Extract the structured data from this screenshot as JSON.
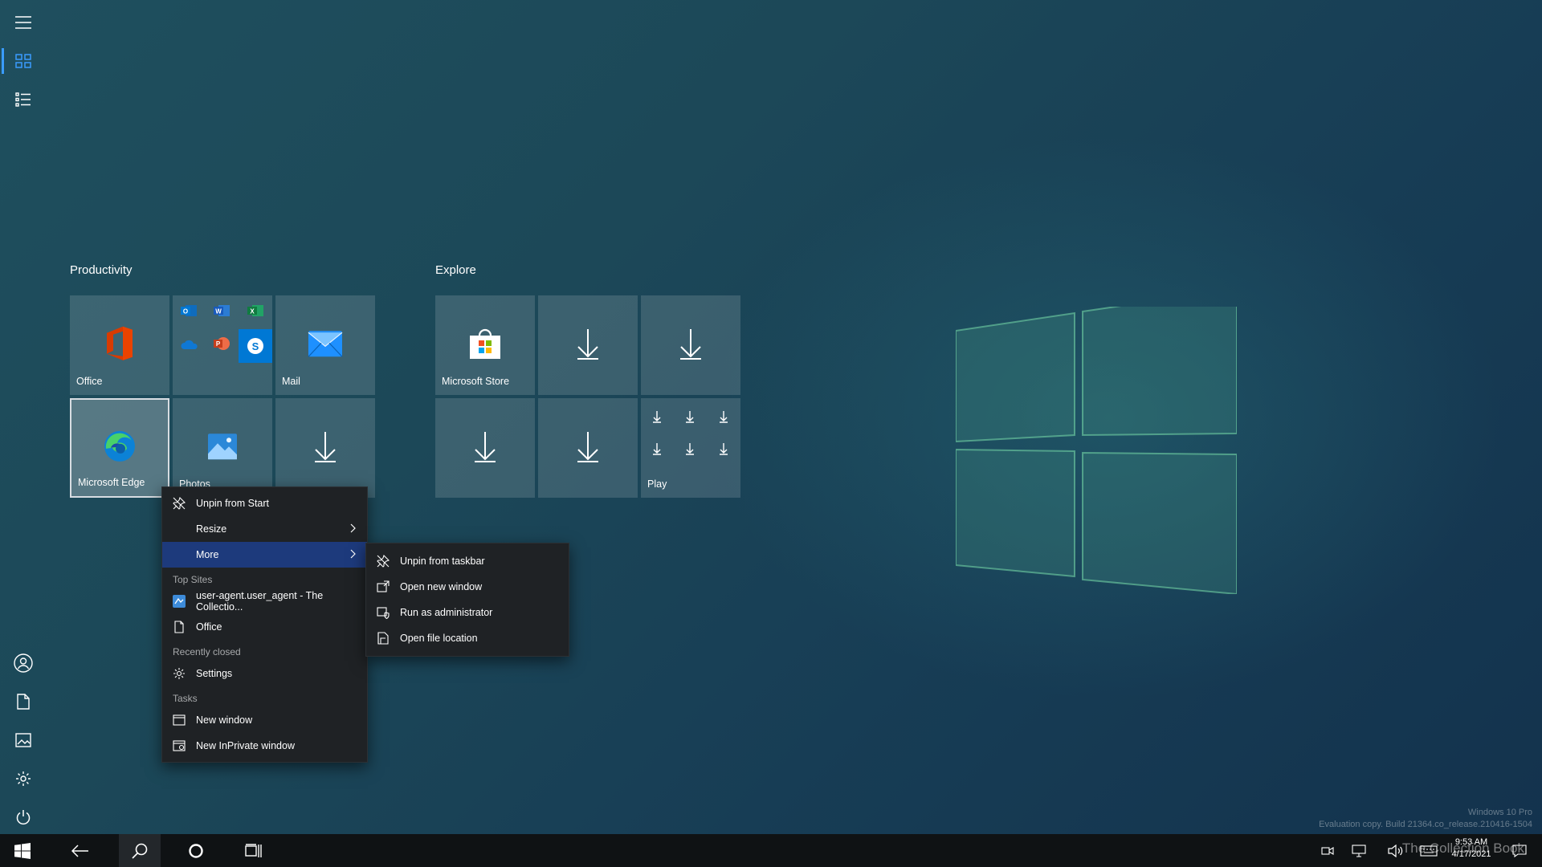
{
  "rail": {
    "items": [
      "menu",
      "pinned-tiles",
      "all-apps",
      "user",
      "documents",
      "pictures",
      "settings",
      "power"
    ]
  },
  "groups": {
    "productivity": {
      "title": "Productivity",
      "tiles": {
        "office": "Office",
        "mail": "Mail",
        "edge": "Microsoft Edge",
        "photos": "Photos"
      }
    },
    "explore": {
      "title": "Explore",
      "tiles": {
        "store": "Microsoft Store",
        "play": "Play"
      }
    }
  },
  "context_menu": {
    "unpin_start": "Unpin from Start",
    "resize": "Resize",
    "more": "More",
    "top_sites_header": "Top Sites",
    "top_site_1": "user-agent.user_agent - The Collectio...",
    "top_site_2": "Office",
    "recently_closed_header": "Recently closed",
    "recent_1": "Settings",
    "tasks_header": "Tasks",
    "task_1": "New window",
    "task_2": "New InPrivate window"
  },
  "submenu": {
    "unpin_taskbar": "Unpin from taskbar",
    "open_new_window": "Open new window",
    "run_admin": "Run as administrator",
    "open_file_location": "Open file location"
  },
  "taskbar": {
    "time": "9:53 AM",
    "date": "4/17/2021"
  },
  "watermark": {
    "line1": "Windows 10 Pro",
    "line2": "Evaluation copy. Build 21364.co_release.210416-1504",
    "brand": "The Collection Book"
  },
  "colors": {
    "accent": "#3a9cff",
    "menu_highlight": "#1d3a7c",
    "taskbar": "#0f1214"
  }
}
